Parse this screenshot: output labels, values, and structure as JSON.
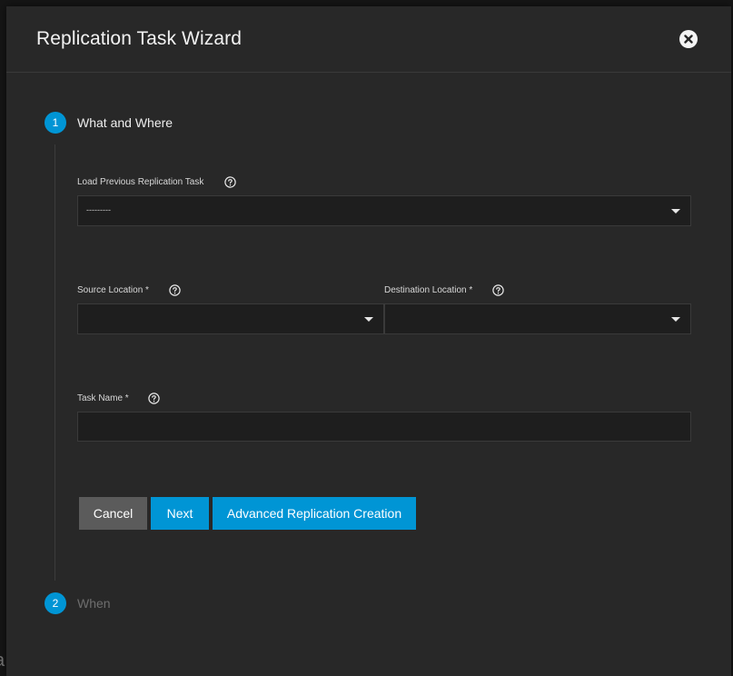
{
  "dialog": {
    "title": "Replication Task Wizard",
    "close_icon": "close-circle-icon"
  },
  "steps": [
    {
      "number": "1",
      "label": "What and Where",
      "active": true
    },
    {
      "number": "2",
      "label": "When",
      "active": false
    }
  ],
  "form": {
    "load_previous": {
      "label": "Load Previous Replication Task",
      "value": "---------"
    },
    "source_location": {
      "label": "Source Location *",
      "value": ""
    },
    "destination_location": {
      "label": "Destination Location *",
      "value": ""
    },
    "task_name": {
      "label": "Task Name *",
      "value": ""
    }
  },
  "buttons": {
    "cancel": "Cancel",
    "next": "Next",
    "advanced": "Advanced Replication Creation"
  },
  "colors": {
    "accent": "#0095d5",
    "dialog_bg": "#282828",
    "input_bg": "#1e1e1e",
    "cancel_bg": "#5b5b5b"
  }
}
